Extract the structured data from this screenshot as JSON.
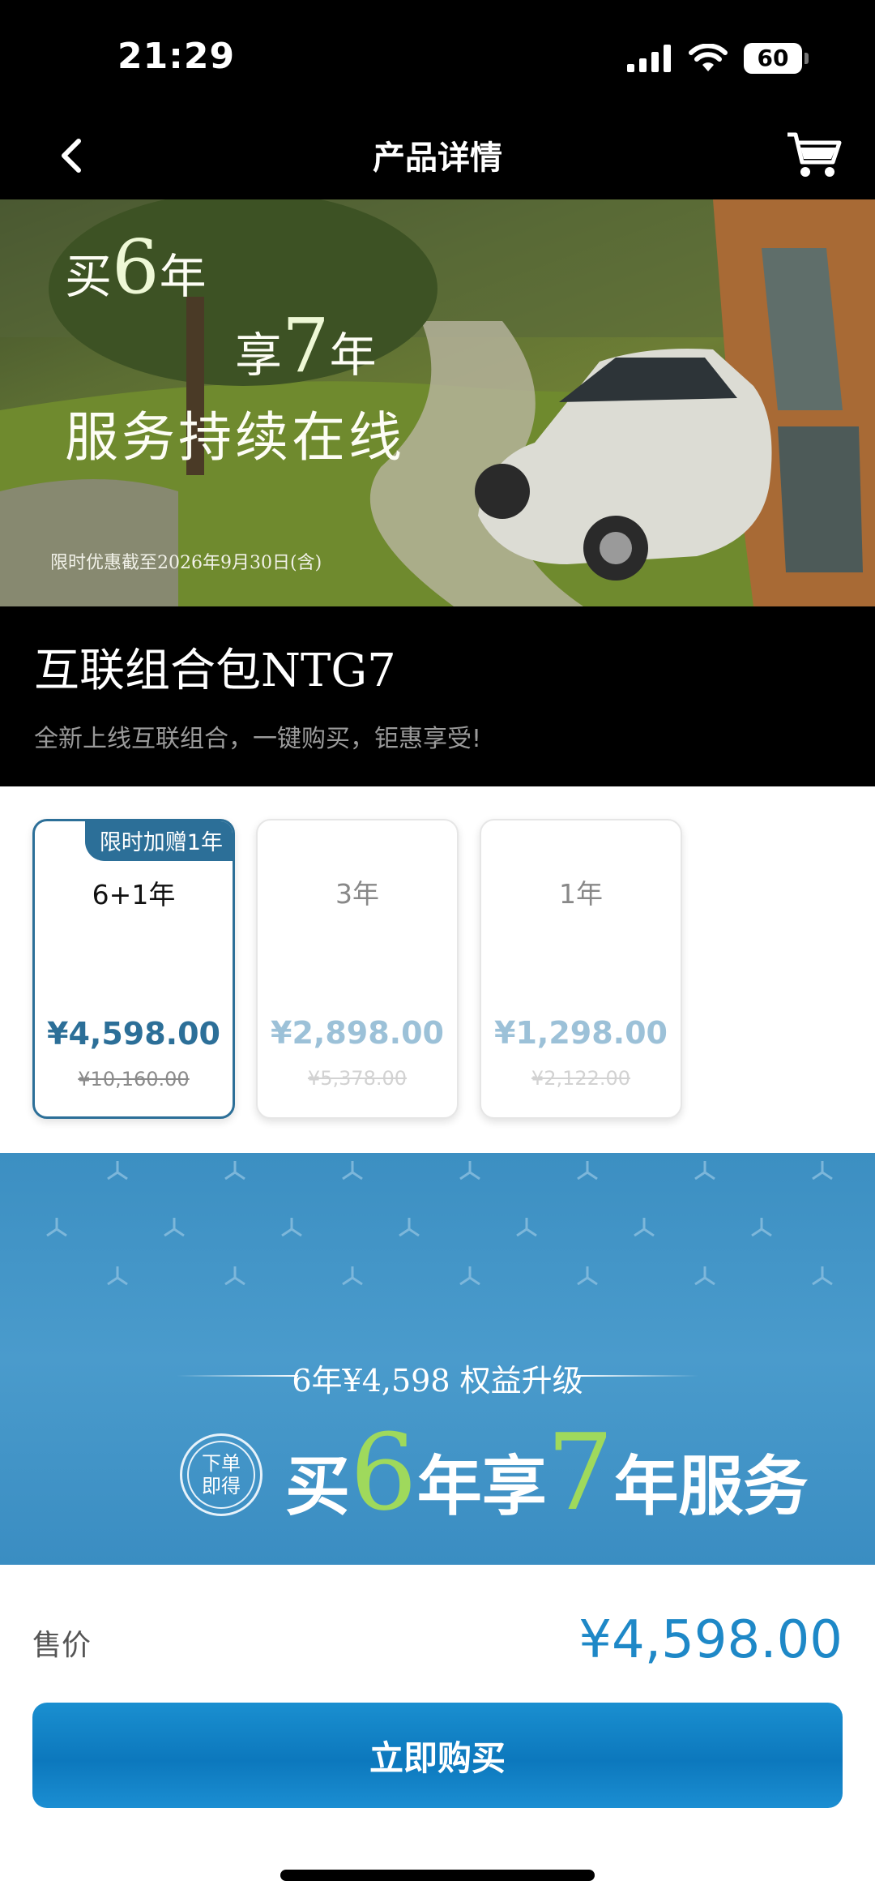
{
  "status_bar": {
    "time": "21:29",
    "battery": "60"
  },
  "nav": {
    "title": "产品详情",
    "back_icon": "chevron-left-icon",
    "cart_icon": "cart-icon"
  },
  "hero": {
    "line1_prefix": "买",
    "line1_number": "6",
    "line1_suffix": "年",
    "line2_prefix": "享",
    "line2_number": "7",
    "line2_suffix": "年",
    "line3": "服务持续在线",
    "promo_note": "限时优惠截至2026年9月30日(含)"
  },
  "product": {
    "name": "互联组合包NTG7",
    "subtitle": "全新上线互联组合，一键购买，钜惠享受!"
  },
  "packages": [
    {
      "tag": "限时加赠1年",
      "label": "6+1年",
      "price": "¥4,598.00",
      "original_price": "¥10,160.00",
      "selected": true
    },
    {
      "tag": "",
      "label": "3年",
      "price": "¥2,898.00",
      "original_price": "¥5,378.00",
      "selected": false
    },
    {
      "tag": "",
      "label": "1年",
      "price": "¥1,298.00",
      "original_price": "¥2,122.00",
      "selected": false
    }
  ],
  "promo_banner": {
    "subline": "6年¥4,598 权益升级",
    "seal_line1": "下单",
    "seal_line2": "即得",
    "main_prefix": "买",
    "main_num1": "6",
    "main_mid": "年享",
    "main_num2": "7",
    "main_suffix": "年服务"
  },
  "footer": {
    "price_label": "售价",
    "price_value": "¥4,598.00",
    "buy_label": "立即购买"
  },
  "colors": {
    "accent": "#2c6f98",
    "price_blue": "#1e88c7",
    "button_blue": "#0c78bd",
    "promo_blue": "#4a9bcc",
    "promo_green": "#9fd95c"
  }
}
